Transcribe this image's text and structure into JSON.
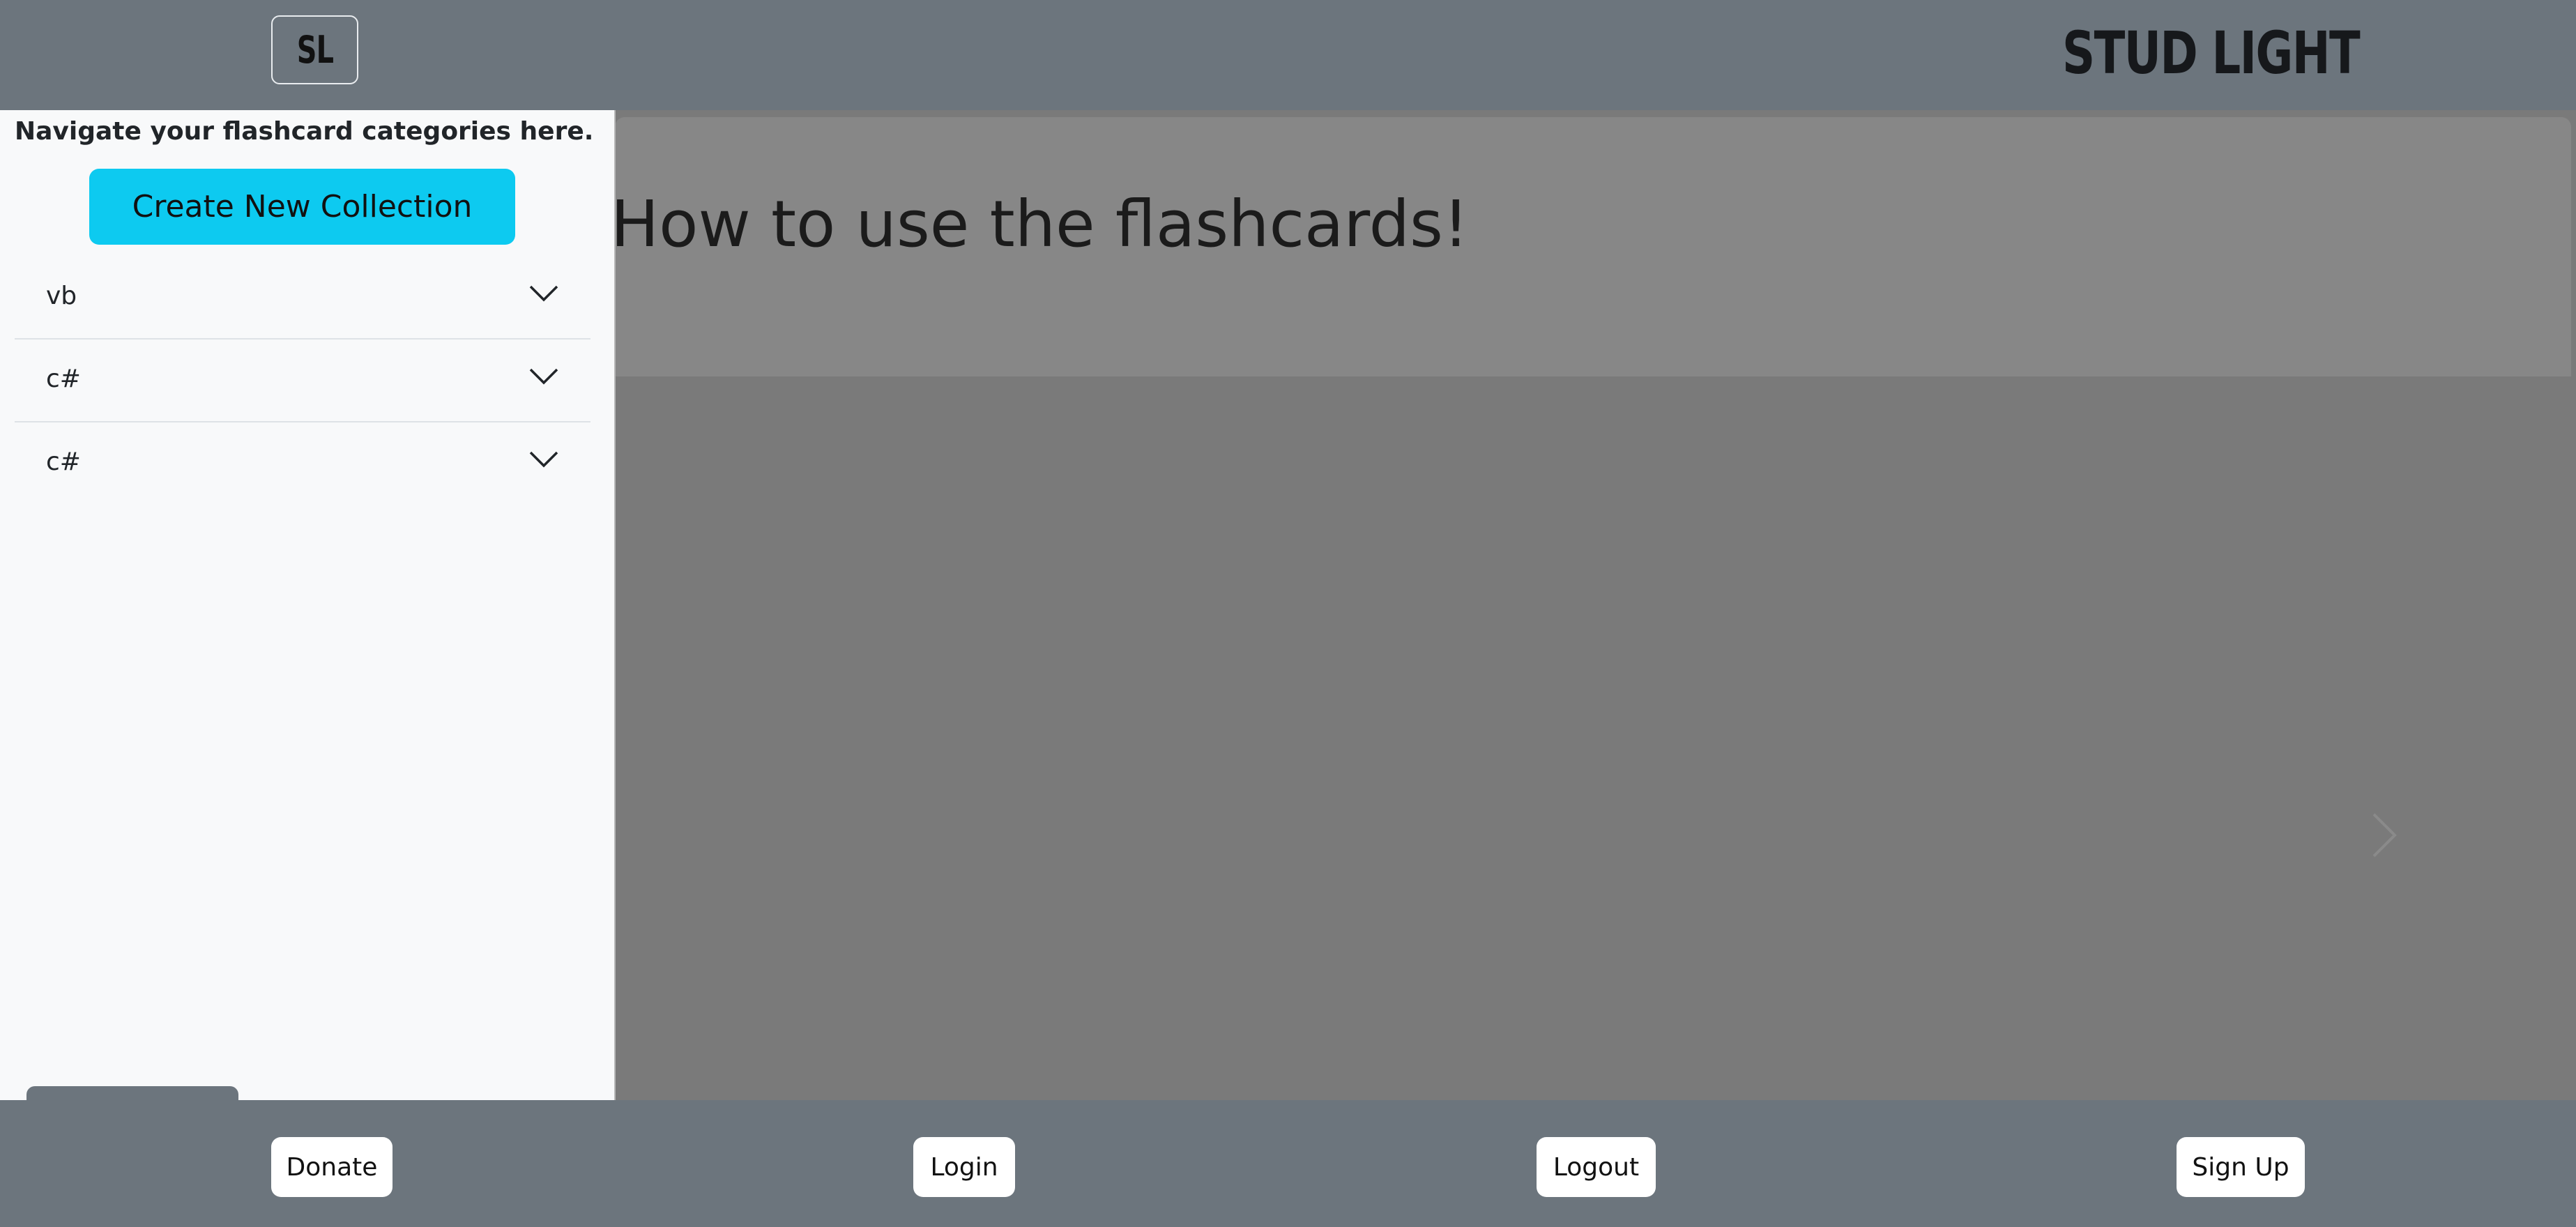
{
  "header": {
    "logo_text": "SL",
    "brand": "STUD LIGHT"
  },
  "sidebar": {
    "description": "Navigate your flashcard categories here.",
    "create_button": "Create New Collection",
    "collections": [
      {
        "label": "vb"
      },
      {
        "label": "c#"
      },
      {
        "label": "c#"
      }
    ]
  },
  "main": {
    "carousel_title": "How to use the flashcards!"
  },
  "footer": {
    "donate": "Donate",
    "login": "Login",
    "logout": "Logout",
    "signup": "Sign Up"
  },
  "colors": {
    "navbar": "#6c757d",
    "sidebar_bg": "#f8f9fa",
    "accent": "#0dcaf0",
    "overlay": "#7a7a7a"
  },
  "icons": {
    "accordion_toggle": "chevron-down-icon",
    "carousel_next": "chevron-right-icon"
  }
}
